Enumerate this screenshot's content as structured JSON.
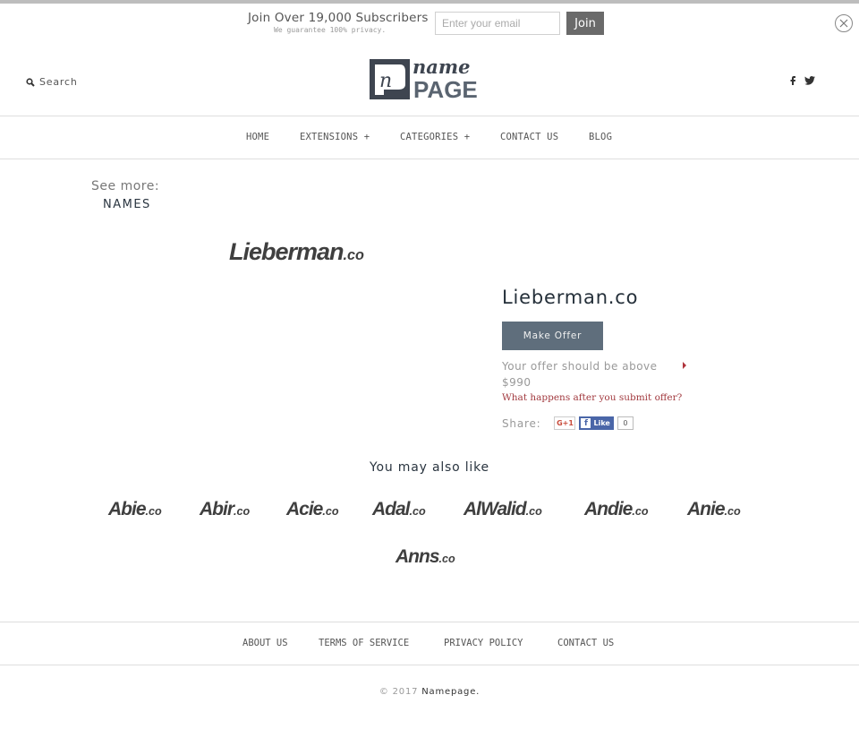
{
  "subscribe": {
    "title": "Join Over 19,000 Subscribers",
    "note": "We guarantee 100% privacy.",
    "email_placeholder": "Enter your email",
    "email_value": "",
    "join_label": "Join",
    "close_icon": "close-circle-icon"
  },
  "header": {
    "search_label": "Search",
    "search_icon": "search-icon",
    "logo": {
      "line1": "name",
      "line2": "PAGE",
      "mark": "n"
    },
    "social": [
      "facebook-icon",
      "twitter-icon"
    ]
  },
  "nav": {
    "items": [
      {
        "label": "HOME"
      },
      {
        "label": "EXTENSIONS +"
      },
      {
        "label": "CATEGORIES +"
      },
      {
        "label": "CONTACT US"
      },
      {
        "label": "BLOG"
      }
    ]
  },
  "sidebar": {
    "see_more": "See more:",
    "names_link": "NAMES"
  },
  "product": {
    "logo_name": "Lieberman",
    "logo_tld": ".co",
    "title": "Lieberman.co",
    "make_offer": "Make Offer",
    "offer_note": "Your offer should be above $990",
    "what_happens": "What happens after you submit offer?",
    "share_label": "Share:",
    "gplus_label": "G+1",
    "fb_like_label": "Like",
    "fb_like_count": "0",
    "colors": {
      "button": "#5f6e7c",
      "link": "#a23a3f"
    }
  },
  "related": {
    "heading": "You may also like",
    "items": [
      {
        "name": "Abie",
        "tld": ".co"
      },
      {
        "name": "Abir",
        "tld": ".co"
      },
      {
        "name": "Acie",
        "tld": ".co"
      },
      {
        "name": "Adal",
        "tld": ".co"
      },
      {
        "name": "AlWalid",
        "tld": ".co"
      },
      {
        "name": "Andie",
        "tld": ".co"
      },
      {
        "name": "Anie",
        "tld": ".co"
      },
      {
        "name": "Anns",
        "tld": ".co"
      }
    ]
  },
  "footer": {
    "links": [
      {
        "label": "ABOUT US"
      },
      {
        "label": "TERMS OF SERVICE"
      },
      {
        "label": "PRIVACY POLICY"
      },
      {
        "label": "CONTACT US"
      }
    ],
    "copyright_prefix": "© 2017",
    "brand": "Namepage."
  }
}
